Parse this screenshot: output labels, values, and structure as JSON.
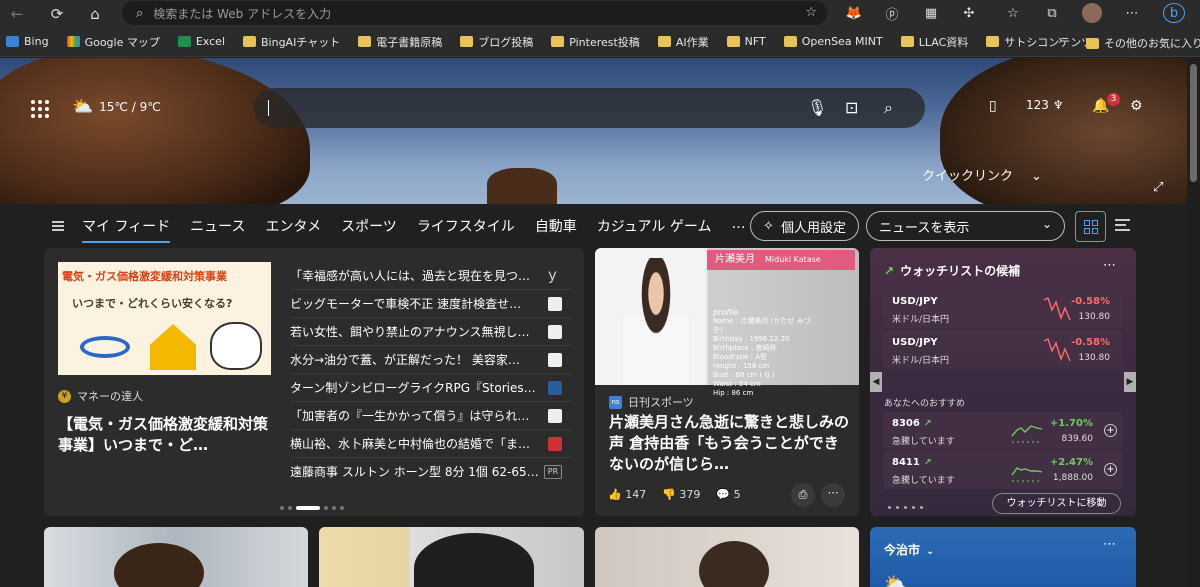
{
  "browser": {
    "address_placeholder": "検索または Web アドレスを入力",
    "bookmarks": [
      {
        "label": "Bing",
        "icon": "bing"
      },
      {
        "label": "Google マップ",
        "icon": "maps"
      },
      {
        "label": "Excel",
        "icon": "excel"
      },
      {
        "label": "BingAIチャット",
        "icon": "folder"
      },
      {
        "label": "電子書籍原稿",
        "icon": "folder"
      },
      {
        "label": "ブログ投稿",
        "icon": "folder"
      },
      {
        "label": "Pinterest投稿",
        "icon": "folder"
      },
      {
        "label": "AI作業",
        "icon": "folder"
      },
      {
        "label": "NFT",
        "icon": "folder"
      },
      {
        "label": "OpenSea MINT",
        "icon": "folder"
      },
      {
        "label": "LLAC資料",
        "icon": "folder"
      },
      {
        "label": "サトシコンテンツ",
        "icon": "folder"
      }
    ],
    "other_favorites": "その他のお気に入り"
  },
  "hero": {
    "weather": "15℃ / 9℃",
    "points": "123",
    "notifications": "3",
    "quick_links": "クイックリンク"
  },
  "nav": {
    "items": [
      "マイ フィード",
      "ニュース",
      "エンタメ",
      "スポーツ",
      "ライフスタイル",
      "自動車",
      "カジュアル ゲーム",
      "…"
    ],
    "personal_settings": "個人用設定",
    "news_display": "ニュースを表示"
  },
  "card1": {
    "promo_title": "電気・ガス価格激変緩和対策事業",
    "promo_subtitle": "いつまで・どれくらい安くなる?",
    "source": "マネーの達人",
    "headline": "【電気・ガス価格激変緩和対策事業】いつまで・ど…",
    "news": [
      "「幸福感が高い人には、過去と現在を見つ…",
      "ビッグモーターで車検不正 速度計検査せ…",
      "若い女性、餌やり禁止のアナウンス無視し…",
      "水分→油分で蓋、が正解だった！ 美容家…",
      "ターン制ゾンビローグライクRPG『Stories…",
      "「加害者の『一生かかって償う』は守られ…",
      "横山裕、水卜麻美と中村倫也の結婚で「ま…",
      "遠藤商事 スルトン ホーン型 8分 1個 62-65…"
    ],
    "pr_label": "PR"
  },
  "card2": {
    "photo_bar": "片瀬美月",
    "photo_name_en": "Miduki Katase",
    "profile_lines": [
      "profile",
      "Name : 片瀬美月 (かたせ みづき)",
      "Birthday : 1996.12.20",
      "Birthplace : 宮崎県",
      "Bloodtype : A型",
      "Height : 158 cm",
      "Bust : 88 cm ( G )",
      "Waist : 54 cm",
      "Hip : 86 cm",
      "Shoes : 22.5 cm"
    ],
    "source": "日刊スポーツ",
    "source_abbr": "ns",
    "headline": "片瀬美月さん急逝に驚きと悲しみの声 倉持由香「もう会うことができないのが信じら…",
    "likes": "147",
    "dislikes": "379",
    "comments": "5"
  },
  "watchlist": {
    "title": "ウォッチリストの候補",
    "forex": [
      {
        "symbol": "USD/JPY",
        "name": "米ドル/日本円",
        "change": "-0.58%",
        "value": "130.80"
      },
      {
        "symbol": "USD/JPY",
        "name": "米ドル/日本円",
        "change": "-0.58%",
        "value": "130.80"
      }
    ],
    "recommend_title": "あなたへのおすすめ",
    "stocks": [
      {
        "symbol": "8306",
        "status": "急騰しています",
        "change": "+1.70%",
        "value": "839.60"
      },
      {
        "symbol": "8411",
        "status": "急騰しています",
        "change": "+2.47%",
        "value": "1,888.00"
      }
    ],
    "button": "ウォッチリストに移動",
    "colors": {
      "down": "#ff6b6b",
      "up": "#6ecb63"
    }
  },
  "bottom": {
    "city": "今治市"
  }
}
